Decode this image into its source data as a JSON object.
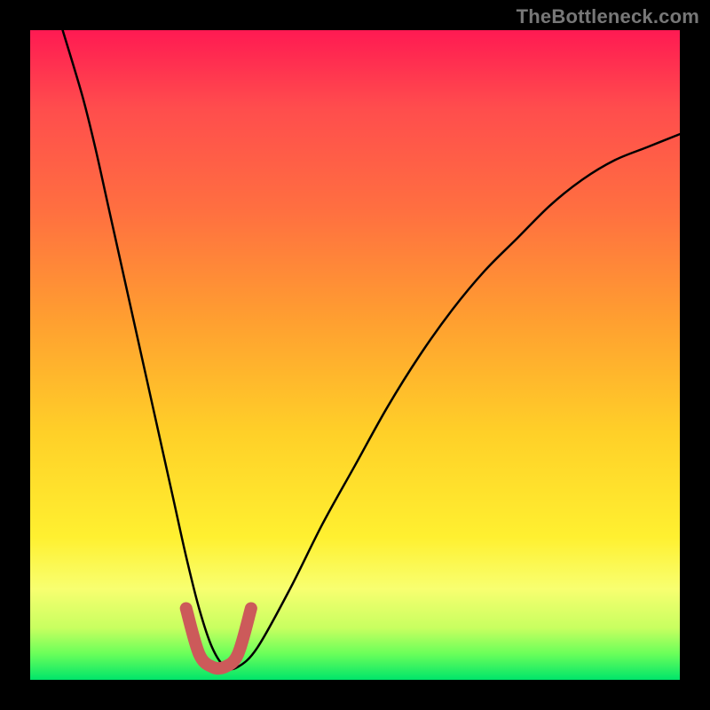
{
  "watermark": "TheBottleneck.com",
  "chart_data": {
    "type": "line",
    "title": "",
    "xlabel": "",
    "ylabel": "",
    "xlim": [
      0,
      100
    ],
    "ylim": [
      0,
      100
    ],
    "grid": false,
    "legend": false,
    "annotations": [],
    "series": [
      {
        "name": "bottleneck-curve",
        "color": "#000000",
        "x": [
          5,
          8,
          10,
          12,
          14,
          16,
          18,
          20,
          22,
          24,
          26,
          28,
          30,
          32,
          35,
          40,
          45,
          50,
          55,
          60,
          65,
          70,
          75,
          80,
          85,
          90,
          95,
          100
        ],
        "y": [
          100,
          90,
          82,
          73,
          64,
          55,
          46,
          37,
          28,
          19,
          11,
          5,
          2,
          2,
          5,
          14,
          24,
          33,
          42,
          50,
          57,
          63,
          68,
          73,
          77,
          80,
          82,
          84
        ]
      },
      {
        "name": "optimal-zone-highlight",
        "color": "#cc5a5a",
        "x": [
          24,
          26,
          28,
          30,
          32,
          34
        ],
        "y": [
          11,
          4,
          2,
          2,
          4,
          11
        ]
      }
    ],
    "gradient_bands": [
      {
        "position": 0.0,
        "color": "#ff1a52"
      },
      {
        "position": 0.12,
        "color": "#ff4d4d"
      },
      {
        "position": 0.28,
        "color": "#ff7040"
      },
      {
        "position": 0.45,
        "color": "#ffa030"
      },
      {
        "position": 0.62,
        "color": "#ffd028"
      },
      {
        "position": 0.78,
        "color": "#fff030"
      },
      {
        "position": 0.86,
        "color": "#f8ff70"
      },
      {
        "position": 0.92,
        "color": "#c8ff60"
      },
      {
        "position": 0.96,
        "color": "#6aff5a"
      },
      {
        "position": 1.0,
        "color": "#00e56a"
      }
    ]
  }
}
